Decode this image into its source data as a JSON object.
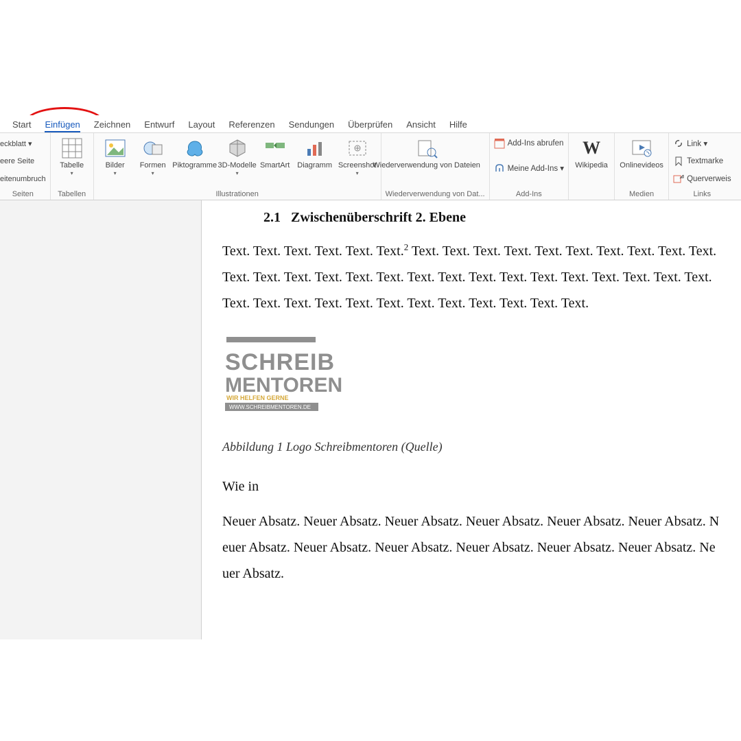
{
  "tabs": [
    "Start",
    "Einfügen",
    "Zeichnen",
    "Entwurf",
    "Layout",
    "Referenzen",
    "Sendungen",
    "Überprüfen",
    "Ansicht",
    "Hilfe"
  ],
  "active_tab_index": 1,
  "groups": {
    "seiten": {
      "label": "Seiten",
      "items": [
        "eckblatt ▾",
        "eere Seite",
        "eitenumbruch"
      ]
    },
    "tabellen": {
      "label": "Tabellen",
      "btn": "Tabelle"
    },
    "illustrationen": {
      "label": "Illustrationen",
      "btns": [
        "Bilder",
        "Formen",
        "Piktogramme",
        "3D-Modelle",
        "SmartArt",
        "Diagramm",
        "Screenshot"
      ]
    },
    "wiederverwendung": {
      "label": "Wiederverwendung von Dat...",
      "btn": "Wiederverwendung von Dateien"
    },
    "addins": {
      "label": "Add-Ins",
      "items": [
        "Add-Ins abrufen",
        "Meine Add-Ins  ▾"
      ]
    },
    "wikipedia": {
      "label": "",
      "btn": "Wikipedia"
    },
    "medien": {
      "label": "Medien",
      "btn": "Onlinevideos"
    },
    "links": {
      "label": "Links",
      "items": [
        "Link  ▾",
        "Textmarke",
        "Querverweis"
      ]
    }
  },
  "doc": {
    "heading_num": "2.1",
    "heading_text": "Zwischenüberschrift 2. Ebene",
    "para1_prefix": "Text. Text. Text. Text. Text. Text.",
    "super": "2",
    "para1_rest": " Text. Text. Text. Text. Text. Text. Text. Text. Text. Text. Text. Text. Text. Text. Text. Text. Text. Text. Text. Text. Text. Text. Text. Text. Text. Text. Text. Text. Text. Text. Text. Text. Text. Text. Text. Text. Text. Text.",
    "logo_line1": "SCHREIB",
    "logo_line2": "MENTOREN",
    "logo_tag": "WIR HELFEN GERNE",
    "logo_url": "WWW.SCHREIBMENTOREN.DE",
    "caption": "Abbildung 1 Logo Schreibmentoren (Quelle)",
    "wiein": "Wie in",
    "neuer": "Neuer Absatz. Neuer Absatz. Neuer Absatz. Neuer Absatz. Neuer Absatz. Neuer Absatz. Neuer Absatz. Neuer Absatz. Neuer Absatz. Neuer Absatz. Neuer Absatz. Neuer Absatz. Neuer Absatz."
  }
}
